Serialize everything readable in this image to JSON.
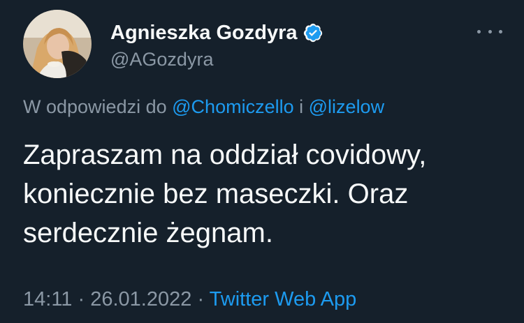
{
  "author": {
    "display_name": "Agnieszka Gozdyra",
    "handle": "@AGozdyra",
    "verified_icon": "verified-badge-icon",
    "avatar": "profile-photo"
  },
  "reply_context": {
    "prefix": "W odpowiedzi do",
    "mention_1": "@Chomiczello",
    "conjunction": "i",
    "mention_2": "@lizelow"
  },
  "tweet": {
    "lines": [
      "Zapraszam na oddział covidowy,",
      "koniecznie bez maseczki. Oraz",
      "serdecznie żegnam."
    ]
  },
  "meta": {
    "time": "14:11",
    "separator": "·",
    "date": "26.01.2022",
    "source": "Twitter Web App"
  },
  "menu": {
    "icon": "more-options-icon"
  },
  "colors": {
    "background": "#15202b",
    "primary_text": "#f7f9f9",
    "secondary_text": "#8b98a5",
    "accent": "#1d9bf0"
  }
}
